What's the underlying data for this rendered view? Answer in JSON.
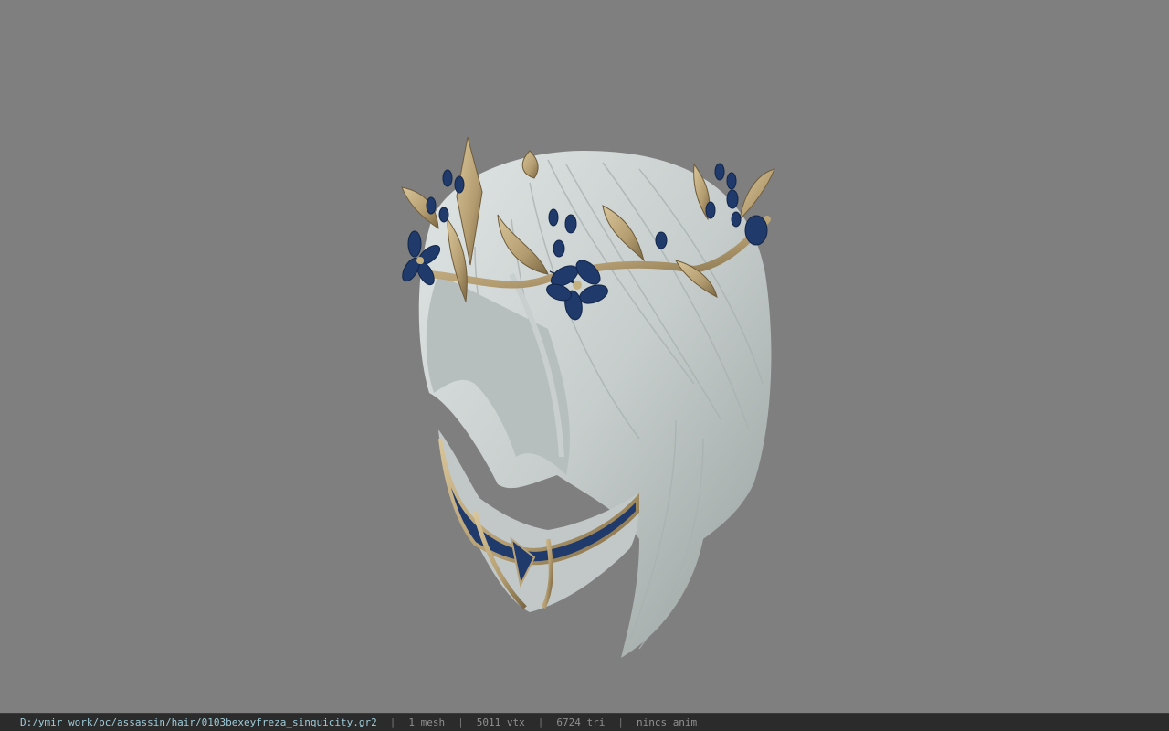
{
  "viewer": {
    "background_color": "#7f7f7f",
    "model_colors": {
      "hair": "#c9d0cf",
      "hair_shadow": "#9ea7a6",
      "gold": "#b8a27a",
      "gold_dark": "#7d6a45",
      "flower": "#1f3a6b"
    }
  },
  "statusbar": {
    "file_path": "D:/ymir work/pc/assassin/hair/0103bexeyfreza_sinquicity.gr2",
    "separator": "|",
    "mesh_count": "1 mesh",
    "vertex_count": "5011 vtx",
    "triangle_count": "6724 tri",
    "anim_status": "nincs anim"
  }
}
